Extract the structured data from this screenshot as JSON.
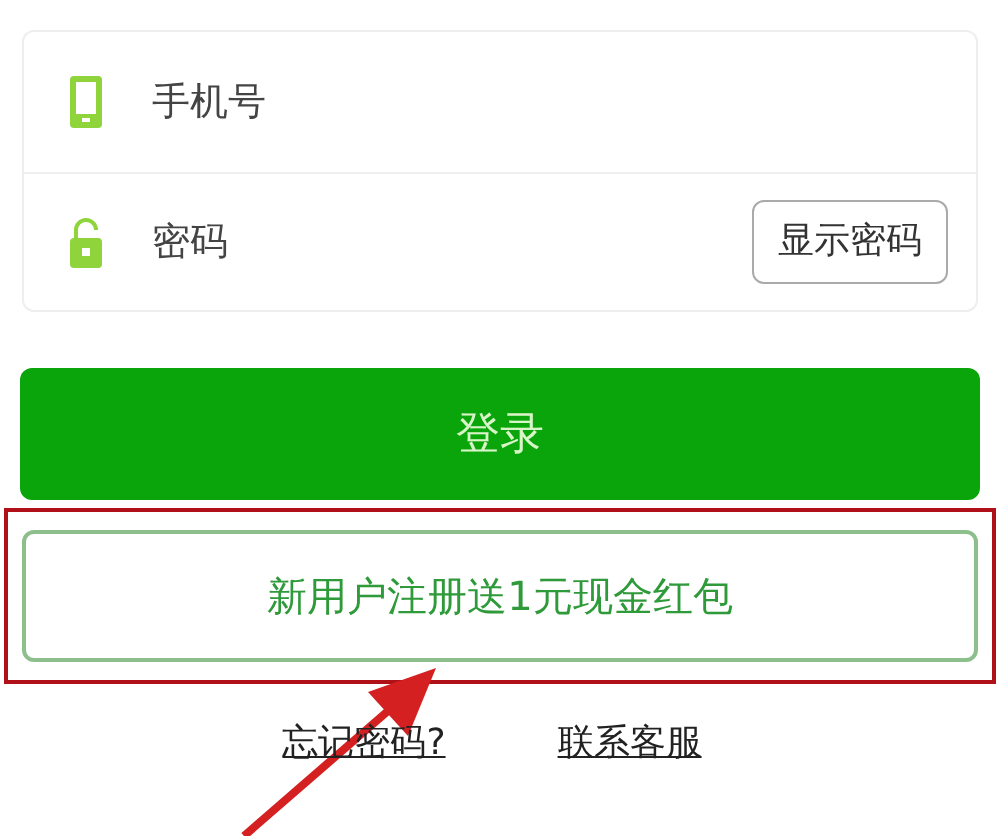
{
  "form": {
    "fields": [
      {
        "kind": "phone",
        "placeholder": "手机号"
      },
      {
        "kind": "password",
        "placeholder": "密码",
        "toggle": "显示密码"
      }
    ]
  },
  "login_button": "登录",
  "register_button": "新用户注册送1元现金红包",
  "links": [
    "忘记密码?",
    "联系客服"
  ]
}
